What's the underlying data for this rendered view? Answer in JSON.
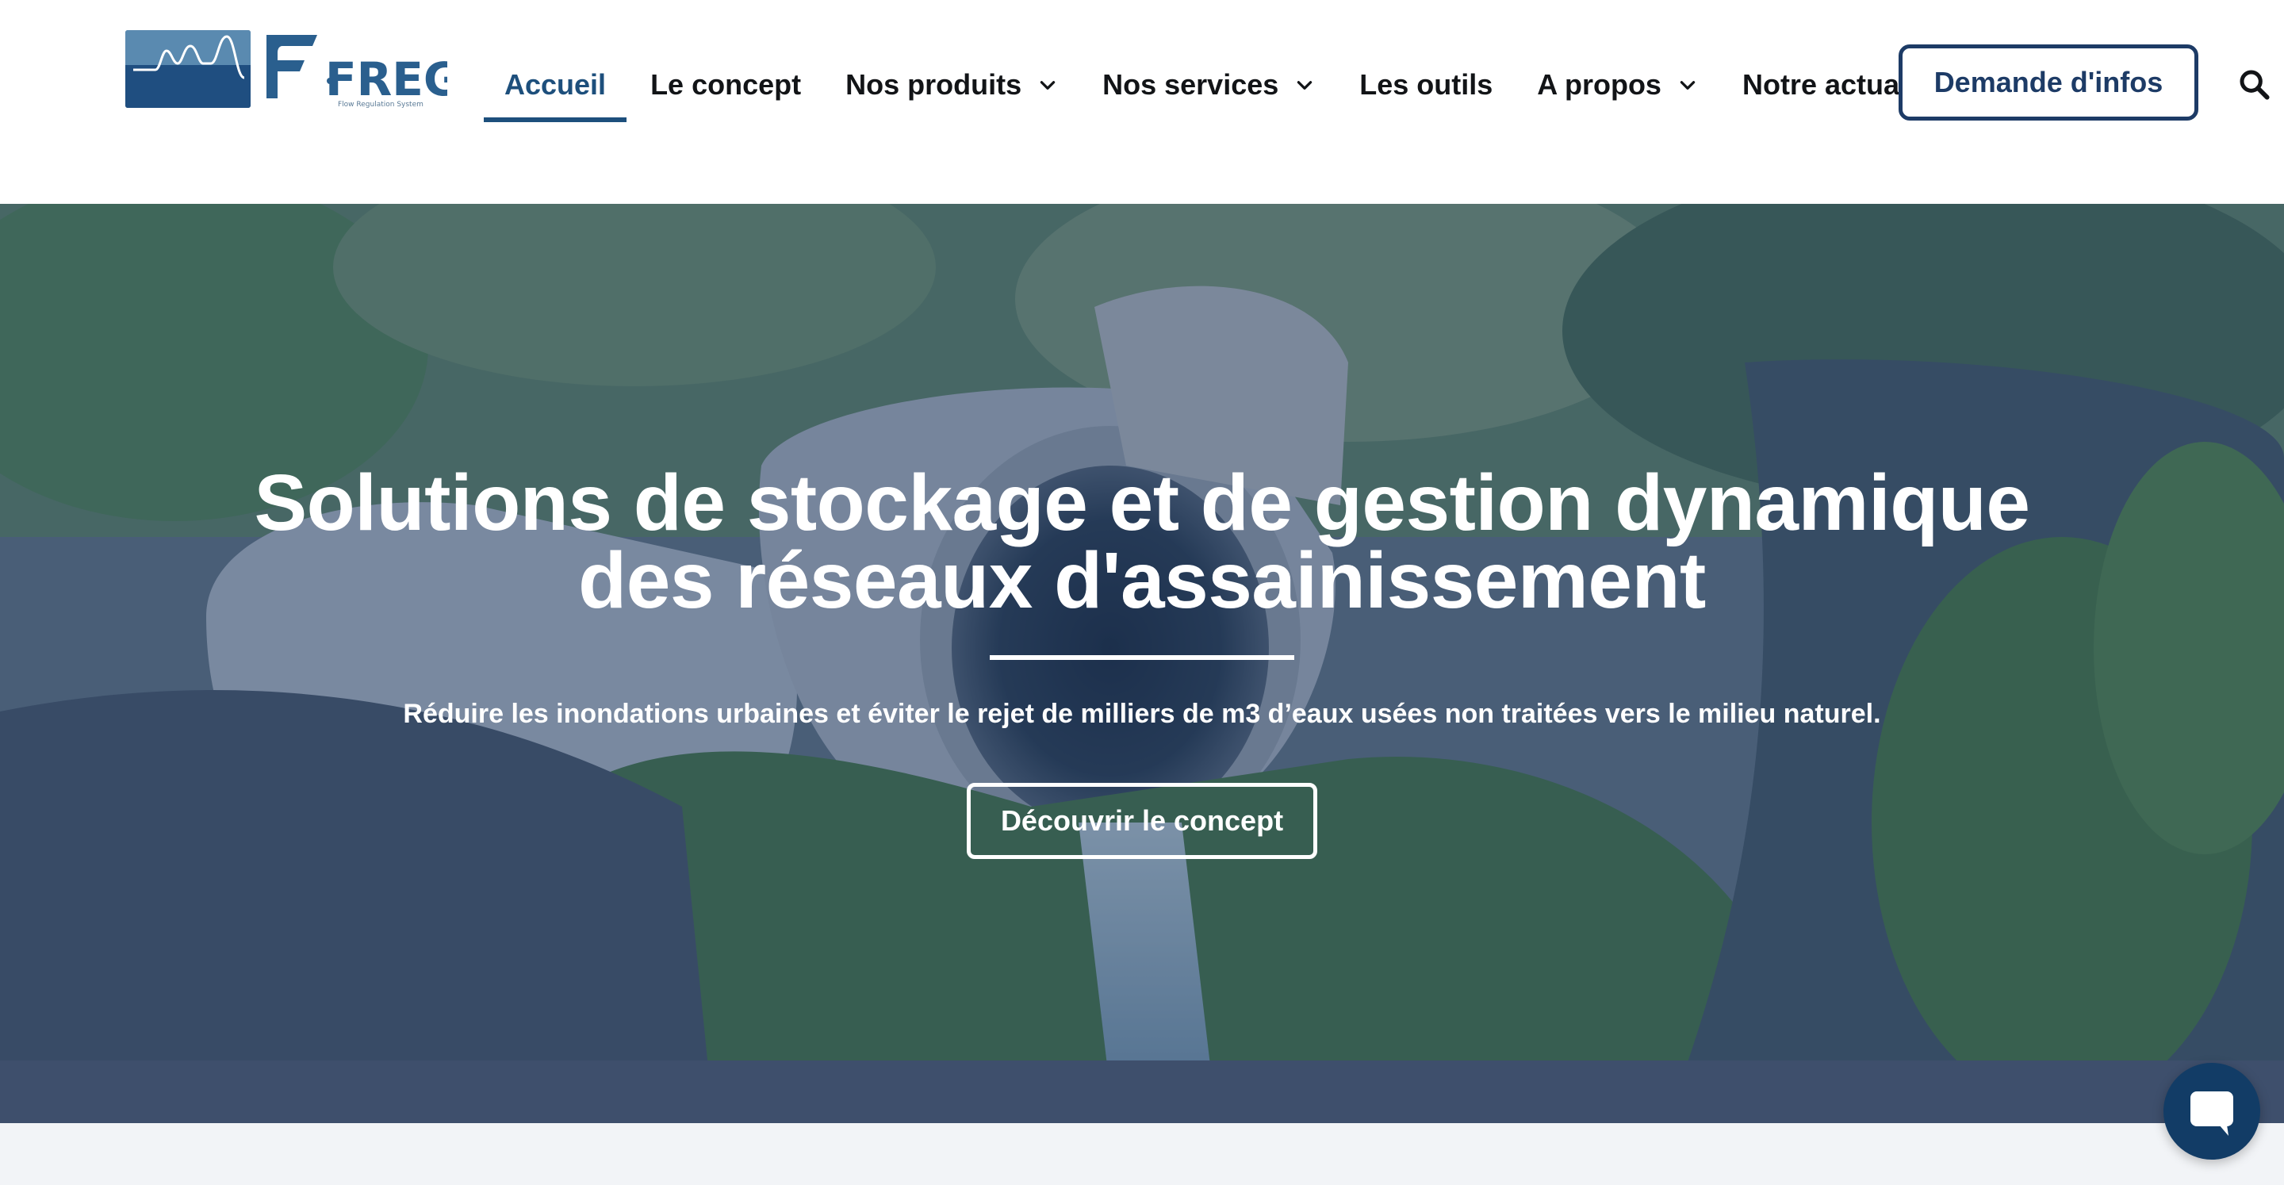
{
  "brand": {
    "name": "FREG",
    "tagline": "Flow Regulation System"
  },
  "nav": {
    "items": [
      {
        "label": "Accueil",
        "active": true,
        "dropdown": false
      },
      {
        "label": "Le concept",
        "active": false,
        "dropdown": false
      },
      {
        "label": "Nos produits",
        "active": false,
        "dropdown": true
      },
      {
        "label": "Nos services",
        "active": false,
        "dropdown": true
      },
      {
        "label": "Les outils",
        "active": false,
        "dropdown": false
      },
      {
        "label": "A propos",
        "active": false,
        "dropdown": true
      },
      {
        "label": "Notre actualité",
        "active": false,
        "dropdown": false
      }
    ],
    "cta_label": "Demande d'infos",
    "search_icon": "search-icon"
  },
  "hero": {
    "title_line1": "Solutions de stockage et de gestion dynamique",
    "title_line2": "des réseaux d'assainissement",
    "subtitle": "Réduire les inondations urbaines et éviter le rejet de milliers de m3 d’eaux usées non traitées vers le milieu naturel.",
    "button_label": "Découvrir le concept"
  },
  "colors": {
    "brand_blue": "#1d4f7c",
    "cta_border": "#1d3b66",
    "hero_tint": "#1c3c6e",
    "chat_bg": "#123c66"
  }
}
